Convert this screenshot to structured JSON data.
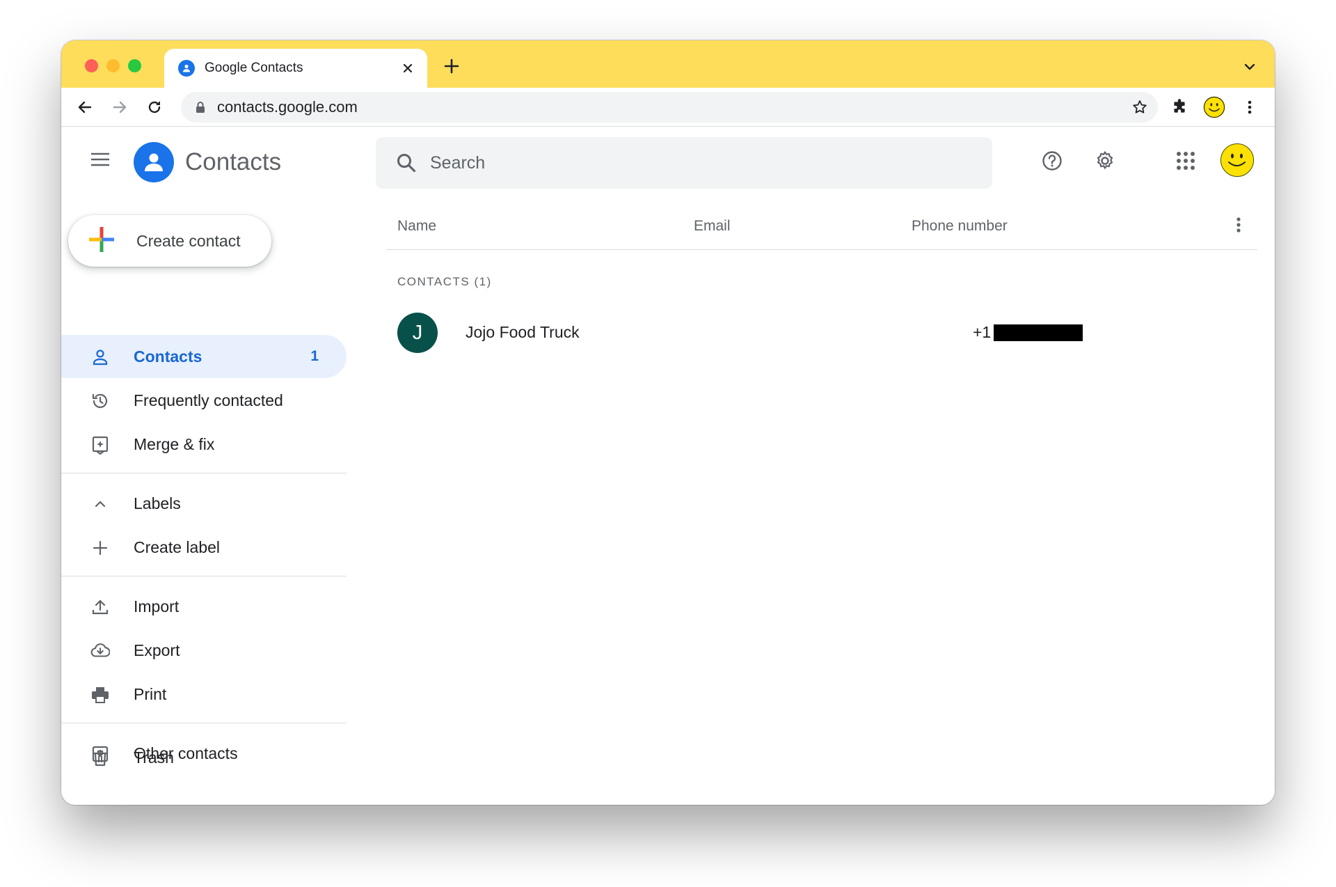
{
  "browser": {
    "tab_title": "Google Contacts",
    "url": "contacts.google.com",
    "colors": {
      "tab_strip": "#fedd5a",
      "omnibox": "#f1f3f4"
    }
  },
  "app": {
    "name": "Contacts",
    "search_placeholder": "Search",
    "create_label": "Create contact"
  },
  "sidebar": {
    "primary": [
      {
        "label": "Contacts",
        "count": "1",
        "icon": "person-icon",
        "active": true
      },
      {
        "label": "Frequently contacted",
        "icon": "history-icon"
      },
      {
        "label": "Merge & fix",
        "icon": "merge-icon"
      }
    ],
    "labels_header": "Labels",
    "create_label": "Create label",
    "tools": [
      {
        "label": "Import",
        "icon": "upload-icon"
      },
      {
        "label": "Export",
        "icon": "cloud-download-icon"
      },
      {
        "label": "Print",
        "icon": "printer-icon"
      }
    ],
    "other": [
      {
        "label": "Other contacts",
        "icon": "archive-icon"
      },
      {
        "label": "Trash",
        "icon": "trash-icon"
      }
    ]
  },
  "table": {
    "columns": [
      "Name",
      "Email",
      "Phone number"
    ],
    "group_label": "CONTACTS (1)",
    "rows": [
      {
        "initial": "J",
        "name": "Jojo Food Truck",
        "email": "",
        "phone_visible": "+1",
        "phone_redacted": true,
        "avatar_color": "#08514a"
      }
    ]
  }
}
